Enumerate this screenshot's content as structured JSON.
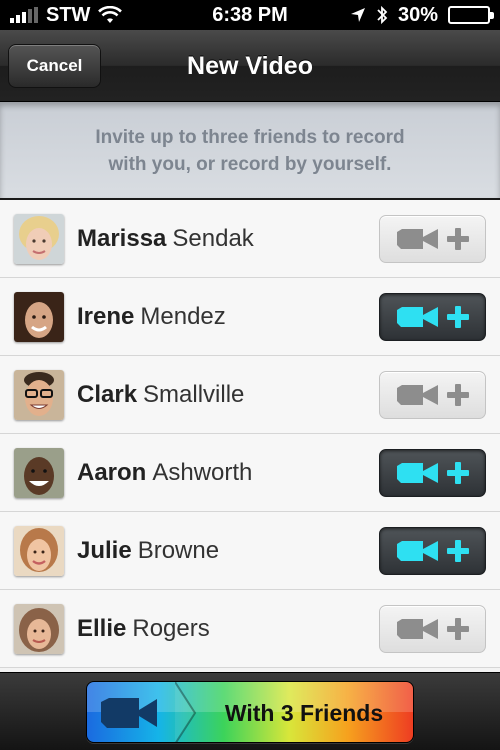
{
  "status_bar": {
    "carrier": "STW",
    "time": "6:38 PM",
    "battery": "30%",
    "battery_level": 0.3
  },
  "nav": {
    "cancel_label": "Cancel",
    "title": "New Video"
  },
  "invite": {
    "line1": "Invite up to three friends to record",
    "line2": "with you, or record by yourself."
  },
  "friends": [
    {
      "first": "Marissa",
      "last": "Sendak",
      "selected": false
    },
    {
      "first": "Irene",
      "last": "Mendez",
      "selected": true
    },
    {
      "first": "Clark",
      "last": "Smallville",
      "selected": false
    },
    {
      "first": "Aaron",
      "last": "Ashworth",
      "selected": true
    },
    {
      "first": "Julie",
      "last": "Browne",
      "selected": true
    },
    {
      "first": "Ellie",
      "last": "Rogers",
      "selected": false
    }
  ],
  "record_button": {
    "label": "With 3 Friends"
  },
  "colors": {
    "toggle_on_icon": "#2ee0f2",
    "toggle_off_icon": "#8d8d8d"
  },
  "icons": {
    "add_video": "video-camera-plus-icon",
    "record": "video-camera-icon"
  }
}
